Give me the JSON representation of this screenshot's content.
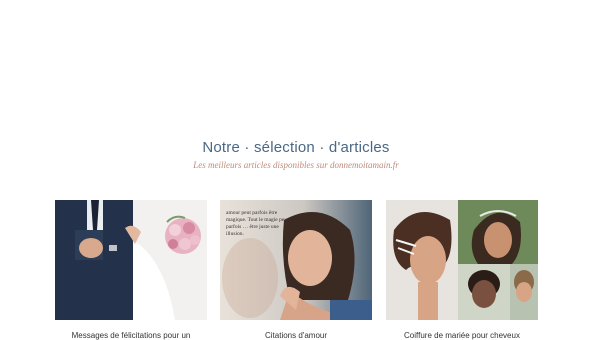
{
  "section": {
    "title": "Notre · sélection · d'articles",
    "subtitle": "Les meilleurs articles disponibles sur donnemoitamain.fr"
  },
  "articles": [
    {
      "caption": "Messages de félicitations pour un",
      "image": "wedding-couple-bouquet-photo"
    },
    {
      "caption": "Citations d'amour",
      "image": "woman-thinking-quote-photo",
      "overlay_text": "amour peut parfois être magique. Tout le magie peut parfois … être juste une illusion."
    },
    {
      "caption": "Coiffure de mariée pour cheveux",
      "image": "bridal-hairstyles-collage-photo"
    }
  ]
}
